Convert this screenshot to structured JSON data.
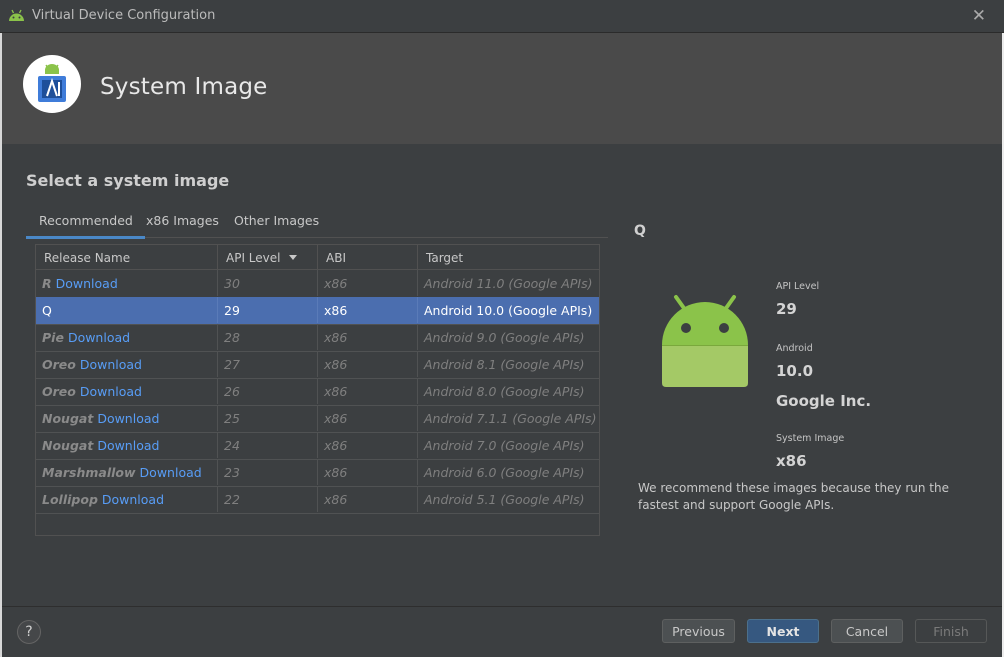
{
  "window": {
    "title": "Virtual Device Configuration"
  },
  "header": {
    "title": "System Image"
  },
  "section_title": "Select a system image",
  "tabs": [
    {
      "label": "Recommended",
      "active": true
    },
    {
      "label": "x86 Images",
      "active": false
    },
    {
      "label": "Other Images",
      "active": false
    }
  ],
  "table": {
    "columns": [
      "Release Name",
      "API Level",
      "ABI",
      "Target"
    ],
    "rows": [
      {
        "name": "R",
        "download": "Download",
        "api": "30",
        "abi": "x86",
        "target": "Android 11.0 (Google APIs)"
      },
      {
        "name": "Q",
        "download": "",
        "api": "29",
        "abi": "x86",
        "target": "Android 10.0 (Google APIs)",
        "selected": true
      },
      {
        "name": "Pie",
        "download": "Download",
        "api": "28",
        "abi": "x86",
        "target": "Android 9.0 (Google APIs)"
      },
      {
        "name": "Oreo",
        "download": "Download",
        "api": "27",
        "abi": "x86",
        "target": "Android 8.1 (Google APIs)"
      },
      {
        "name": "Oreo",
        "download": "Download",
        "api": "26",
        "abi": "x86",
        "target": "Android 8.0 (Google APIs)"
      },
      {
        "name": "Nougat",
        "download": "Download",
        "api": "25",
        "abi": "x86",
        "target": "Android 7.1.1 (Google APIs)"
      },
      {
        "name": "Nougat",
        "download": "Download",
        "api": "24",
        "abi": "x86",
        "target": "Android 7.0 (Google APIs)"
      },
      {
        "name": "Marshmallow",
        "download": "Download",
        "api": "23",
        "abi": "x86",
        "target": "Android 6.0 (Google APIs)"
      },
      {
        "name": "Lollipop",
        "download": "Download",
        "api": "22",
        "abi": "x86",
        "target": "Android 5.1 (Google APIs)"
      }
    ]
  },
  "details": {
    "name": "Q",
    "api_label": "API Level",
    "api_value": "29",
    "android_label": "Android",
    "android_value": "10.0",
    "vendor": "Google Inc.",
    "system_image_label": "System Image",
    "system_image_value": "x86",
    "recommend_text": "We recommend these images because they run the fastest and support Google APIs."
  },
  "footer": {
    "help": "?",
    "previous": "Previous",
    "next": "Next",
    "cancel": "Cancel",
    "finish": "Finish"
  },
  "colors": {
    "accent": "#4a88c7",
    "selection": "#4b6eaf",
    "link": "#589df6",
    "android_green": "#8bc34a"
  }
}
